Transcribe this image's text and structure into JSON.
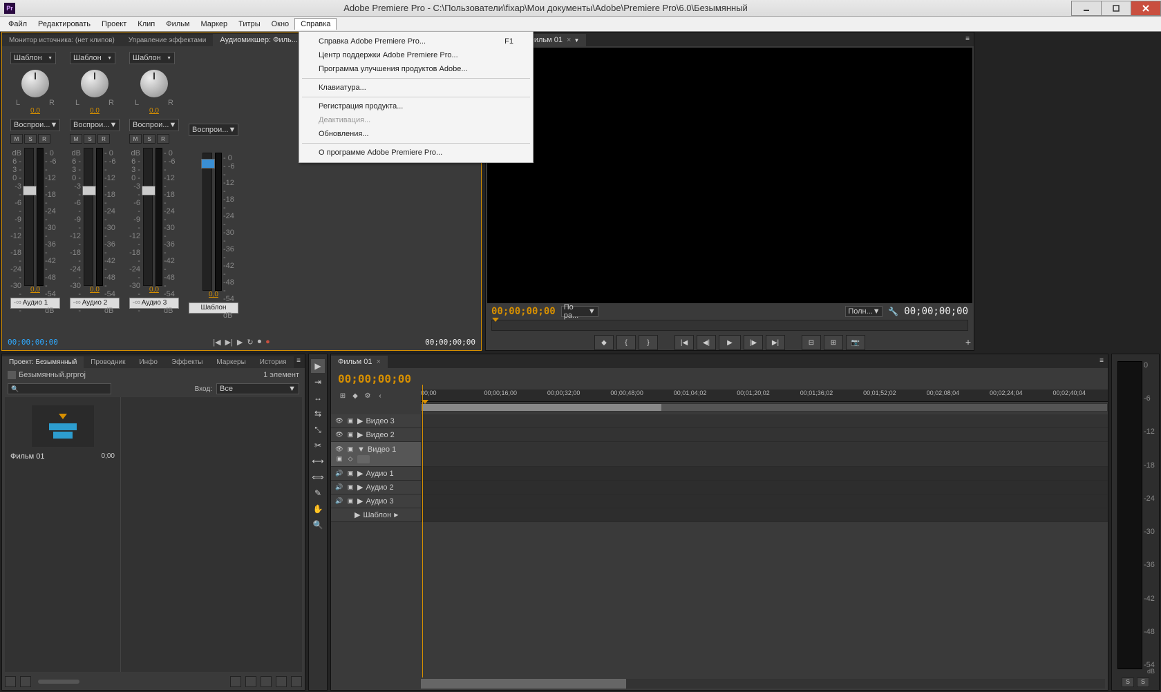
{
  "titlebar": {
    "app_abbr": "Pr",
    "title": "Adobe Premiere Pro - C:\\Пользователи\\fixap\\Мои документы\\Adobe\\Premiere Pro\\6.0\\Безымянный"
  },
  "menubar": {
    "items": [
      "Файл",
      "Редактировать",
      "Проект",
      "Клип",
      "Фильм",
      "Маркер",
      "Титры",
      "Окно",
      "Справка"
    ],
    "active_index": 8
  },
  "help_menu": {
    "items": [
      {
        "label": "Справка Adobe Premiere Pro...",
        "shortcut": "F1"
      },
      {
        "label": "Центр поддержки Adobe Premiere Pro..."
      },
      {
        "label": "Программа улучшения продуктов Adobe..."
      },
      {
        "sep": true
      },
      {
        "label": "Клавиатура..."
      },
      {
        "sep": true
      },
      {
        "label": "Регистрация продукта..."
      },
      {
        "label": "Деактивация...",
        "disabled": true
      },
      {
        "label": "Обновления..."
      },
      {
        "sep": true
      },
      {
        "label": "О программе Adobe Premiere Pro..."
      }
    ]
  },
  "mixer": {
    "tabs": [
      "Монитор источника: (нет клипов)",
      "Управление эффектами",
      "Аудиомикшер: Филь...",
      "ограммы: Фильм 01"
    ],
    "active_tab": 2,
    "template_label": "Шаблон",
    "l": "L",
    "r": "R",
    "pan_value": "0,0",
    "mode": "Воспрои...",
    "m": "M",
    "s": "S",
    "rec": "R",
    "db_left": [
      "dB",
      "6 -",
      "3 -",
      "0 -",
      "-3 -",
      "-6 -",
      "-9 -",
      "-12 -",
      "-18 -",
      "-24 -",
      "-30 -",
      "-∞ -"
    ],
    "db_right": [
      "- 0",
      "- -6",
      "- -12",
      "- -18",
      "- -24",
      "- -30",
      "- -36",
      "- -42",
      "- -48",
      "- -54",
      "- dB"
    ],
    "master_db_right": [
      "- 0",
      "- -6",
      "- -12",
      "- -18",
      "- -24",
      "- -30",
      "- -36",
      "- -42",
      "- -48",
      "- -54",
      "- dB"
    ],
    "gain": "0,0",
    "channels": [
      "Аудио 1",
      "Аудио 2",
      "Аудио 3",
      "Шаблон"
    ],
    "tc_left": "00;00;00;00",
    "tc_right": "00;00;00;00"
  },
  "program": {
    "tab": "ограммы: Фильм 01",
    "tc_left": "00;00;00;00",
    "fit": "По ра...",
    "quality": "Полн...",
    "tc_right": "00;00;00;00"
  },
  "project": {
    "tabs": [
      "Проект: Безымянный",
      "Проводник",
      "Инфо",
      "Эффекты",
      "Маркеры",
      "История"
    ],
    "active_tab": 0,
    "file": "Безымянный.prproj",
    "count": "1 элемент",
    "in_label": "Вход:",
    "in_value": "Все",
    "item_name": "Фильм 01",
    "item_dur": "0;00"
  },
  "timeline": {
    "tab": "Фильм 01",
    "tc": "00;00;00;00",
    "ruler": [
      "00;00",
      "00;00;16;00",
      "00;00;32;00",
      "00;00;48;00",
      "00;01;04;02",
      "00;01;20;02",
      "00;01;36;02",
      "00;01;52;02",
      "00;02;08;04",
      "00;02;24;04",
      "00;02;40;04"
    ],
    "tracks": {
      "v3": "Видео 3",
      "v2": "Видео 2",
      "v1": "Видео 1",
      "a1": "Аудио 1",
      "a2": "Аудио 2",
      "a3": "Аудио 3",
      "master": "Шаблон"
    }
  },
  "rmeter": {
    "scale": [
      "0",
      "-6",
      "-12",
      "-18",
      "-24",
      "-30",
      "-36",
      "-42",
      "-48",
      "-54"
    ],
    "db": "dB",
    "s": "S"
  }
}
